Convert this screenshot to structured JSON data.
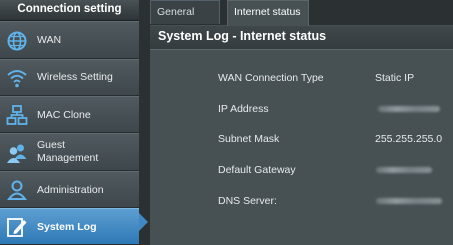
{
  "sidebar": {
    "title": "Connection setting",
    "items": [
      {
        "label": "WAN",
        "icon": "globe-icon"
      },
      {
        "label": "Wireless Setting",
        "icon": "wifi-icon"
      },
      {
        "label": "MAC Clone",
        "icon": "network-icon"
      },
      {
        "label": "Guest\nManagement",
        "icon": "users-icon"
      },
      {
        "label": "Administration",
        "icon": "user-icon"
      },
      {
        "label": "System Log",
        "icon": "edit-log-icon"
      }
    ],
    "active_index": 5
  },
  "tabs": [
    {
      "label": "General Log"
    },
    {
      "label": "Internet status"
    }
  ],
  "panel": {
    "title": "System Log - Internet status",
    "rows": [
      {
        "label": "WAN Connection Type",
        "value": "Static IP"
      },
      {
        "label": "IP Address",
        "value": ""
      },
      {
        "label": "Subnet Mask",
        "value": "255.255.255.0"
      },
      {
        "label": "Default Gateway",
        "value": ""
      },
      {
        "label": "DNS Server:",
        "value": ""
      }
    ]
  },
  "colors": {
    "sidebar_bg": "#3b4246",
    "active_item": "#3f88c4",
    "panel_bg": "#475154"
  }
}
